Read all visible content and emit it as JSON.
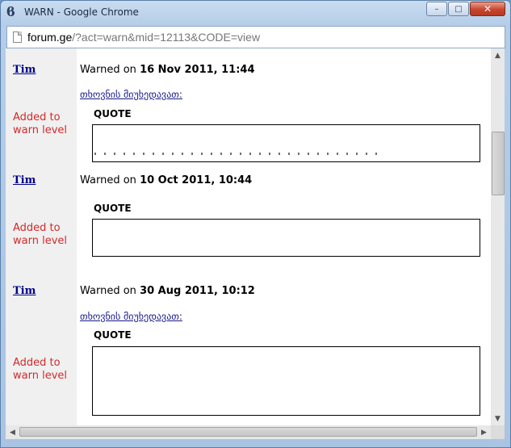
{
  "window": {
    "title": "WARN - Google Chrome",
    "icon_glyph": "ϐ",
    "icon": "chrome-app-icon",
    "controls": {
      "minimize": "–",
      "maximize": "□",
      "close": "✕"
    }
  },
  "address_bar": {
    "host": "forum.ge",
    "path": "/?act=warn&mid=12113&CODE=view"
  },
  "entries": [
    {
      "user": "Tim",
      "warned_prefix": "Warned on",
      "date": "16 Nov 2011, 11:44",
      "topic_link": "თხოვნის მიუხედავათ:",
      "added_label": "Added to warn level",
      "quote_title": "QUOTE"
    },
    {
      "user": "Tim",
      "warned_prefix": "Warned on",
      "date": "10 Oct 2011, 10:44",
      "topic_link": "",
      "added_label": "Added to warn level",
      "quote_title": "QUOTE"
    },
    {
      "user": "Tim",
      "warned_prefix": "Warned on",
      "date": "30 Aug 2011, 10:12",
      "topic_link": "თხოვნის მიუხედავათ:",
      "added_label": "Added to warn level",
      "quote_title": "QUOTE"
    }
  ],
  "scrollbars": {
    "up": "▲",
    "down": "▼",
    "left": "◀",
    "right": "▶"
  },
  "colors": {
    "link": "#00008b",
    "added_label": "#d22a2a",
    "side_column": "#f0f0f0"
  }
}
